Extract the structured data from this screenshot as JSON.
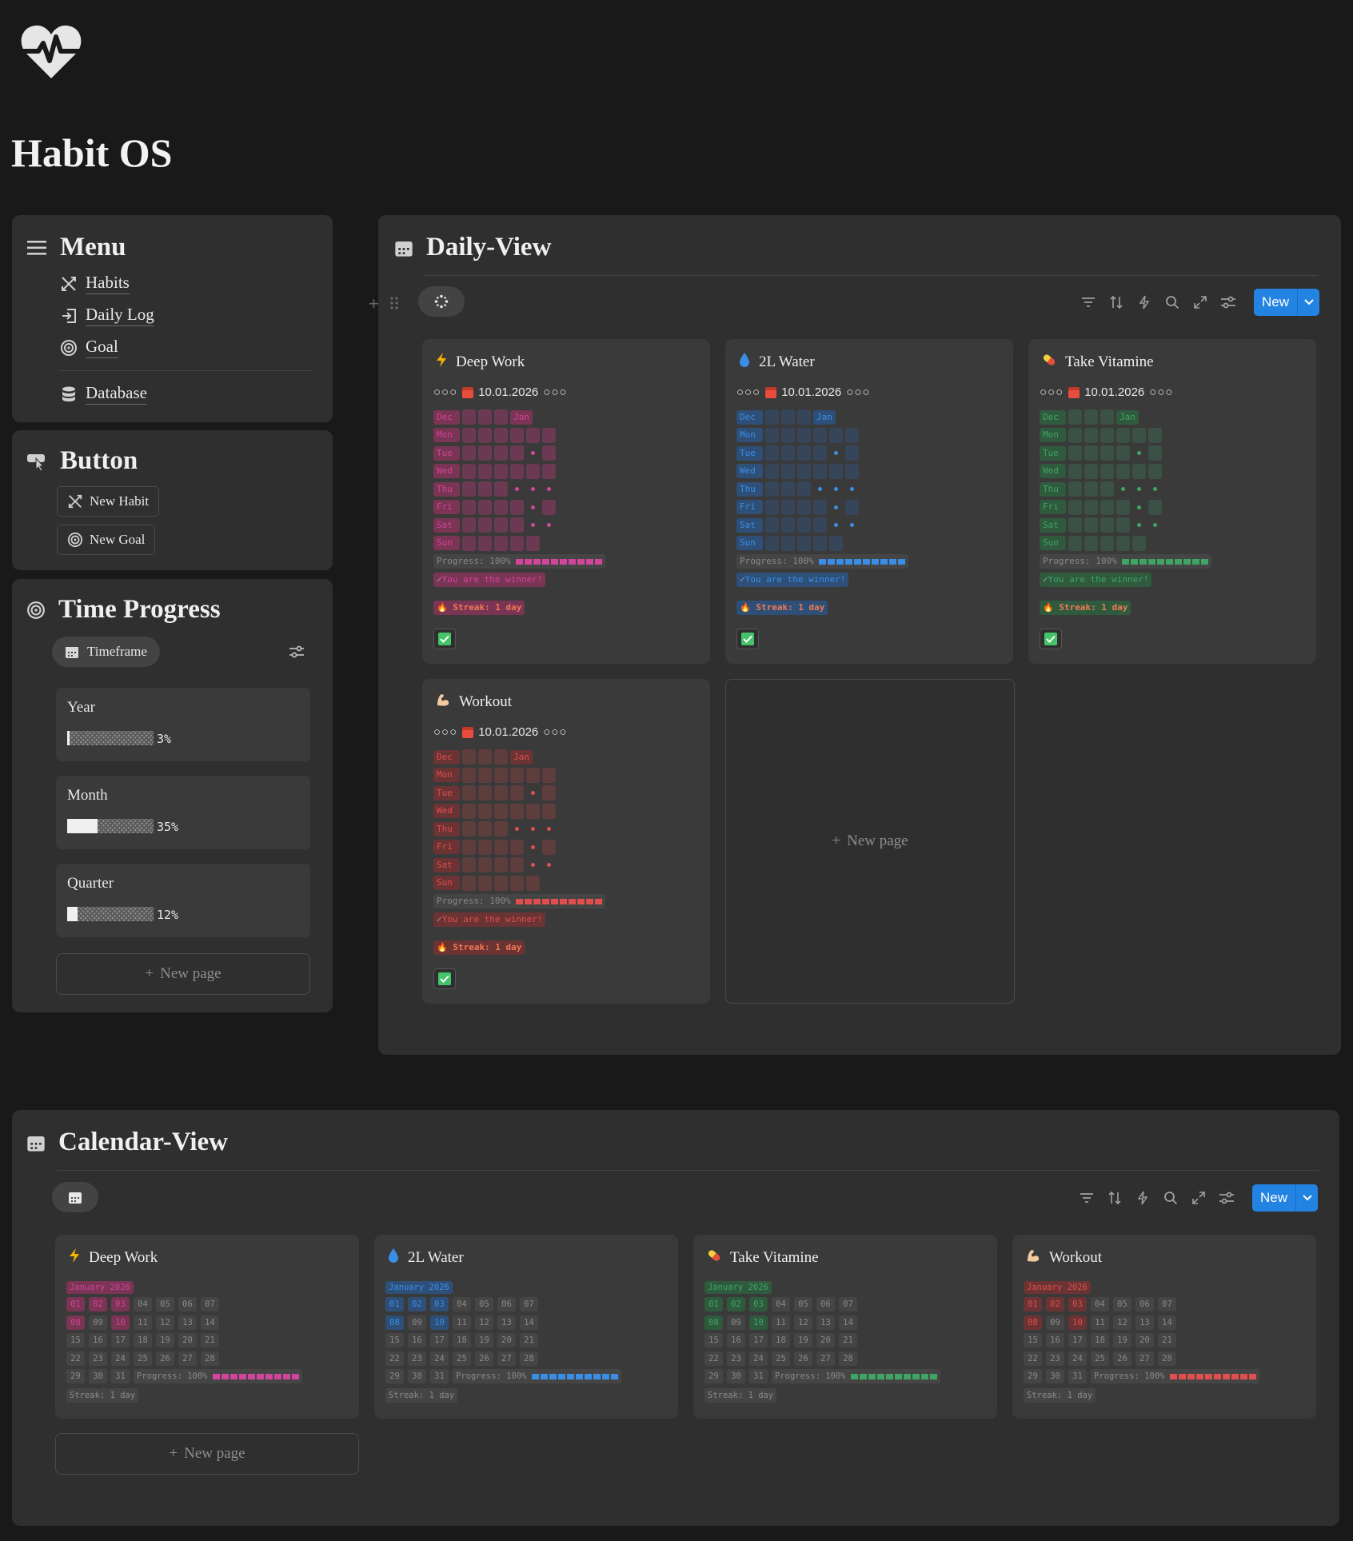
{
  "page": {
    "title": "Habit OS",
    "logo_icon": "heart-pulse-icon"
  },
  "menu": {
    "title": "Menu",
    "items": [
      {
        "label": "Habits",
        "icon": "habits-icon"
      },
      {
        "label": "Daily Log",
        "icon": "log-in-icon"
      },
      {
        "label": "Goal",
        "icon": "target-icon"
      },
      {
        "label": "Database",
        "icon": "database-icon"
      }
    ]
  },
  "buttons": {
    "title": "Button",
    "items": [
      {
        "label": "New Habit",
        "icon": "habits-icon"
      },
      {
        "label": "New Goal",
        "icon": "target-icon"
      }
    ]
  },
  "time_progress": {
    "title": "Time Progress",
    "view_label": "Timeframe",
    "items": [
      {
        "label": "Year",
        "percent": 3,
        "percent_text": "3%"
      },
      {
        "label": "Month",
        "percent": 35,
        "percent_text": "35%"
      },
      {
        "label": "Quarter",
        "percent": 12,
        "percent_text": "12%"
      }
    ],
    "new_page": "New page"
  },
  "daily_view": {
    "title": "Daily-View",
    "new_label": "New",
    "new_page": "New page",
    "habits": [
      {
        "name": "Deep Work",
        "icon": "lightning-icon",
        "date": "10.01.2026",
        "fg": "#d1459a",
        "cell": "#6b3a52",
        "chip_bg": "#7a3454",
        "progress": "Progress: 100%",
        "winner": "You are the winner!",
        "streak": "Streak: 1 day",
        "checked": true
      },
      {
        "name": "2L Water",
        "icon": "droplet-icon",
        "date": "10.01.2026",
        "fg": "#3b8ee6",
        "cell": "#36455a",
        "chip_bg": "#2d4f78",
        "progress": "Progress: 100%",
        "winner": "You are the winner!",
        "streak": "Streak: 1 day",
        "checked": true
      },
      {
        "name": "Take Vitamine",
        "icon": "pill-icon",
        "date": "10.01.2026",
        "fg": "#3fa564",
        "cell": "#3c5145",
        "chip_bg": "#2f5a3e",
        "progress": "Progress: 100%",
        "winner": "You are the winner!",
        "streak": "Streak: 1 day",
        "checked": true
      },
      {
        "name": "Workout",
        "icon": "muscle-icon",
        "date": "10.01.2026",
        "fg": "#e04e4e",
        "cell": "#5e3d3d",
        "chip_bg": "#6b3333",
        "progress": "Progress: 100%",
        "winner": "You are the winner!",
        "streak": "Streak: 1 day",
        "checked": true
      }
    ],
    "row_labels": [
      "Dec",
      "Mon",
      "Tue",
      "Wed",
      "Thu",
      "Fri",
      "Sat",
      "Sun"
    ],
    "month_label": "Jan"
  },
  "calendar_view": {
    "title": "Calendar-View",
    "new_label": "New",
    "new_page": "New page",
    "month": "January 2026",
    "weeks": [
      [
        "01",
        "02",
        "03",
        "04",
        "05",
        "06",
        "07"
      ],
      [
        "08",
        "09",
        "10",
        "11",
        "12",
        "13",
        "14"
      ],
      [
        "15",
        "16",
        "17",
        "18",
        "19",
        "20",
        "21"
      ],
      [
        "22",
        "23",
        "24",
        "25",
        "26",
        "27",
        "28"
      ],
      [
        "29",
        "30",
        "31"
      ]
    ],
    "done_days": [
      "01",
      "02",
      "03",
      "08",
      "10"
    ],
    "progress": "Progress: 100%",
    "streak": "Streak: 1 day"
  }
}
